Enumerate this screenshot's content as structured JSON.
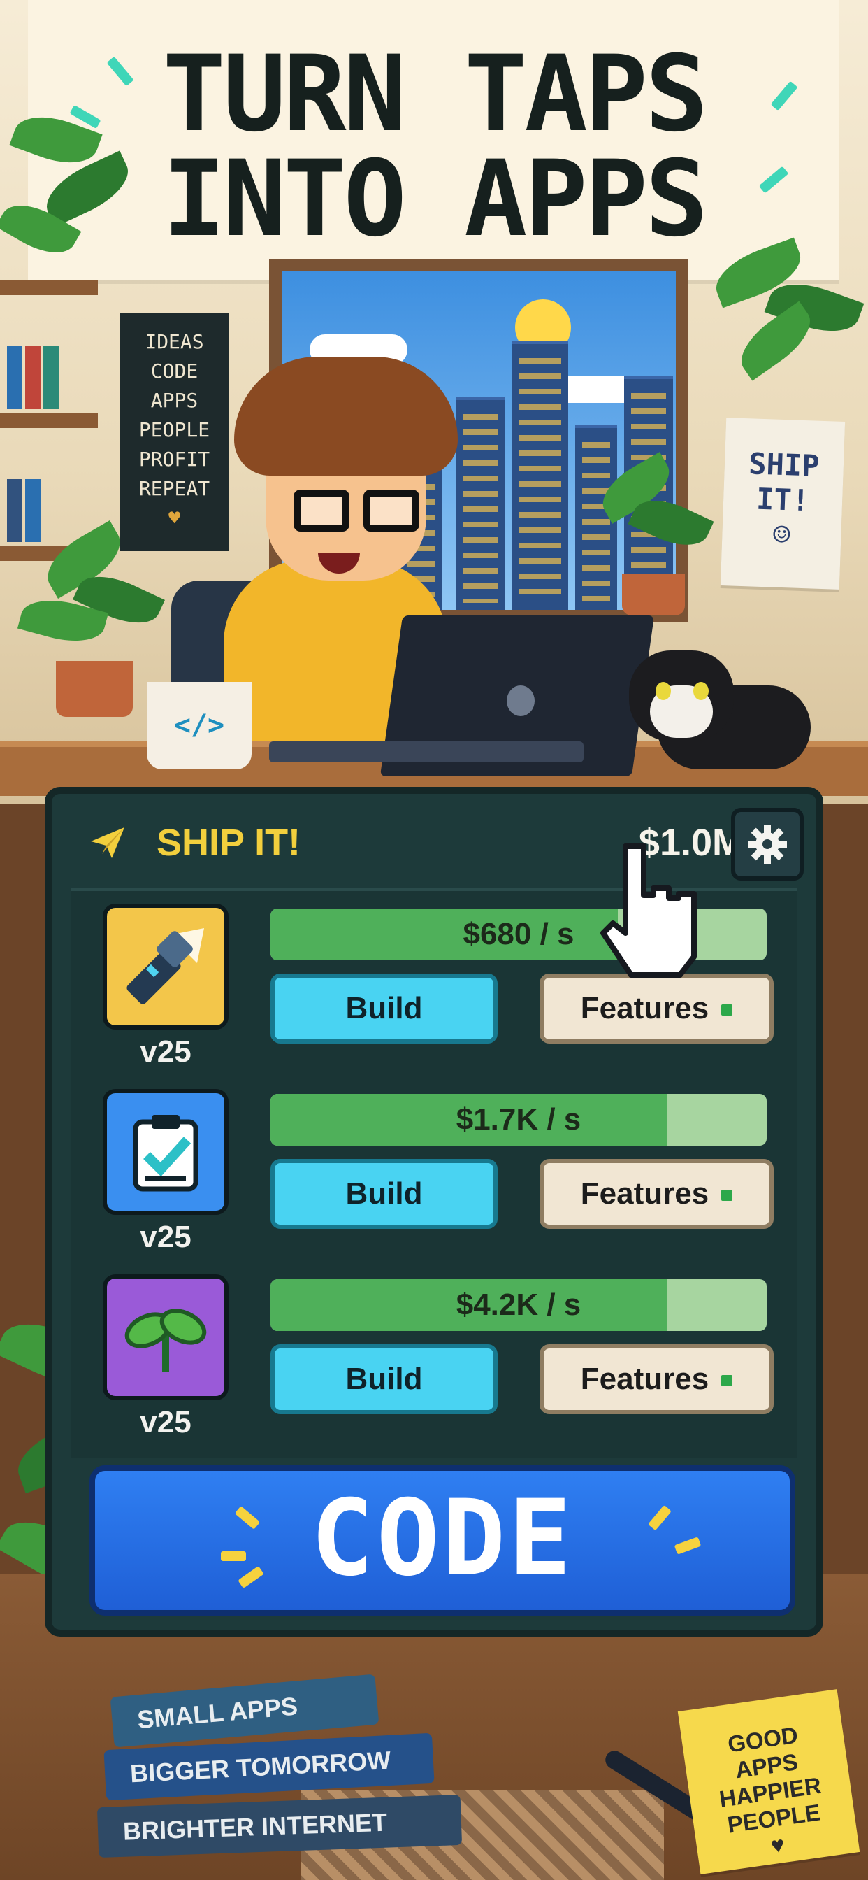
{
  "banner": {
    "line1": "TURN TAPS",
    "line2": "INTO APPS"
  },
  "poster": {
    "lines": [
      "IDEAS",
      "CODE",
      "APPS",
      "PEOPLE",
      "PROFIT",
      "REPEAT"
    ]
  },
  "wall_note": {
    "line1": "SHIP",
    "line2": "IT!"
  },
  "mug": {
    "label": "</>"
  },
  "hud": {
    "title": "SHIP IT!",
    "money": "$1.0M",
    "title_icon": "paper-plane-icon",
    "settings_icon": "gear-icon"
  },
  "apps": [
    {
      "icon": "flashlight-icon",
      "icon_bg": "#f3c64a",
      "version": "v25",
      "rate": "$680 / s",
      "progress": 0.7,
      "build_label": "Build",
      "features_label": "Features"
    },
    {
      "icon": "checklist-icon",
      "icon_bg": "#3a8ff0",
      "version": "v25",
      "rate": "$1.7K / s",
      "progress": 0.8,
      "build_label": "Build",
      "features_label": "Features"
    },
    {
      "icon": "sprout-icon",
      "icon_bg": "#9a5ad8",
      "version": "v25",
      "rate": "$4.2K / s",
      "progress": 0.8,
      "build_label": "Build",
      "features_label": "Features"
    }
  ],
  "code_button": {
    "label": "CODE"
  },
  "books": [
    "SMALL APPS",
    "BIGGER TOMORROW",
    "BRIGHTER INTERNET"
  ],
  "sticky_note": {
    "lines": [
      "GOOD",
      "APPS",
      "HAPPIER",
      "PEOPLE"
    ]
  },
  "colors": {
    "accent_gold": "#f2cf3d",
    "build_cyan": "#49d3f2",
    "code_blue": "#2f7ff2",
    "panel_teal": "#1d3a3a",
    "progress_green": "#4fb05a"
  }
}
